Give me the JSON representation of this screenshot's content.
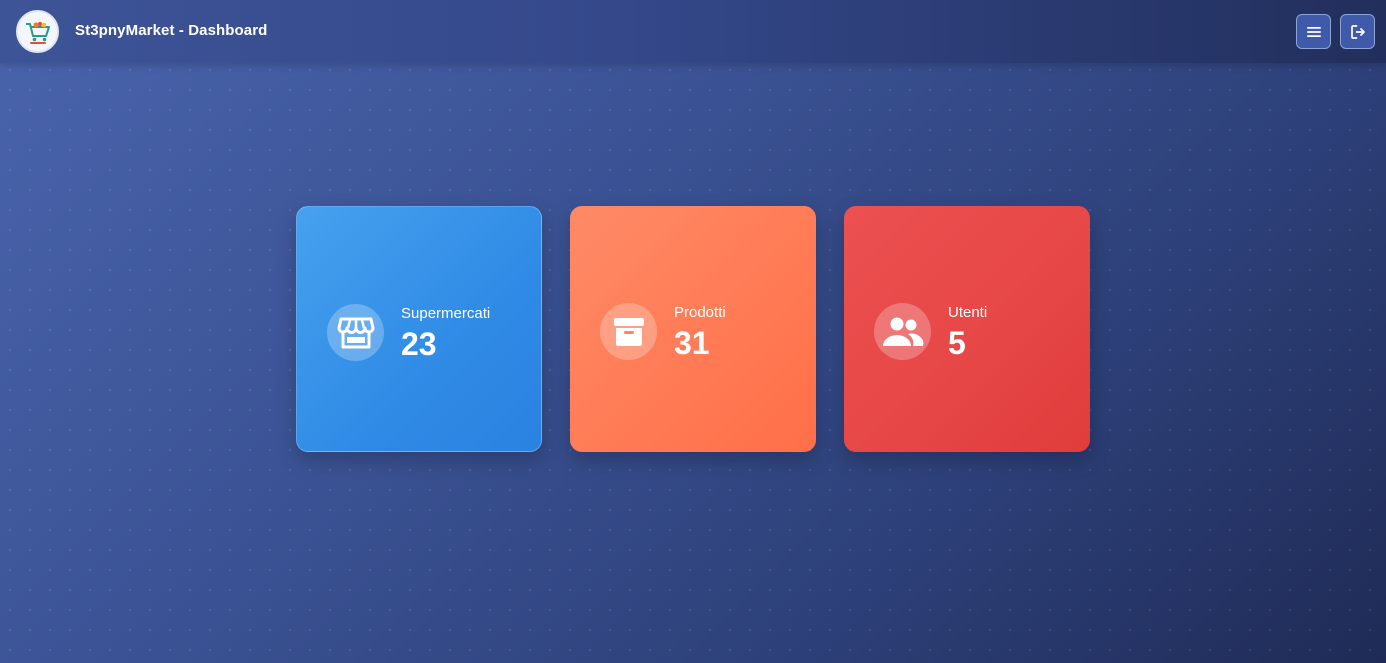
{
  "header": {
    "title": "St3pnyMarket - Dashboard",
    "logo_icon": "shopping-cart-logo",
    "menu_icon": "hamburger-menu-icon",
    "logout_icon": "logout-icon"
  },
  "stats": [
    {
      "label": "Supermercati",
      "value": "23",
      "icon": "store-icon",
      "color": "#2f8be5"
    },
    {
      "label": "Prodotti",
      "value": "31",
      "icon": "archive-box-icon",
      "color": "#ff7a54"
    },
    {
      "label": "Utenti",
      "value": "5",
      "icon": "users-icon",
      "color": "#e64646"
    }
  ]
}
